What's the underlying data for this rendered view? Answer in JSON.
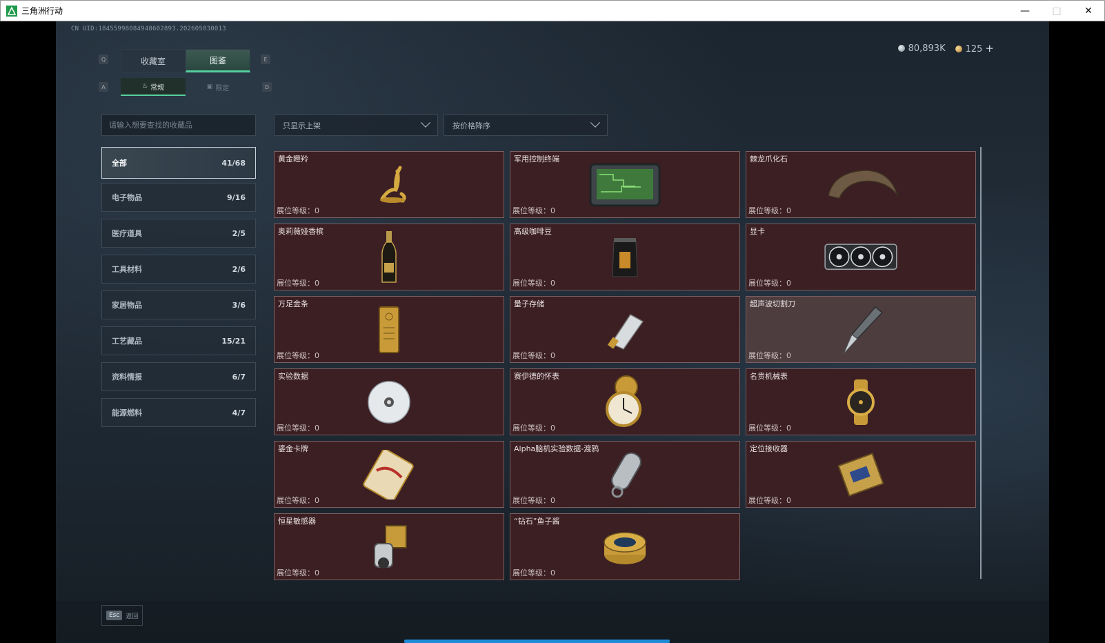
{
  "window": {
    "title": "三角洲行动"
  },
  "header": {
    "uid": "CN UID:18455998084948602893.202605030013",
    "currency_silver": "80,893K",
    "currency_gold": "125",
    "plus": "+"
  },
  "tabs": [
    {
      "label": "收藏室",
      "active": false
    },
    {
      "label": "图鉴",
      "active": true
    }
  ],
  "tab_keys": {
    "left": "Q",
    "right": "E"
  },
  "subtabs": [
    {
      "label": "常规",
      "active": true
    },
    {
      "label": "限定",
      "active": false
    }
  ],
  "subtab_keys": {
    "left": "A",
    "right": "D"
  },
  "search": {
    "placeholder": "请输入想要查找的收藏品"
  },
  "filters": {
    "listing": "只显示上架",
    "sort": "按价格降序"
  },
  "categories": [
    {
      "label": "全部",
      "count": "41/68",
      "active": true
    },
    {
      "label": "电子物品",
      "count": "9/16"
    },
    {
      "label": "医疗道具",
      "count": "2/5"
    },
    {
      "label": "工具材料",
      "count": "2/6"
    },
    {
      "label": "家居物品",
      "count": "3/6"
    },
    {
      "label": "工艺藏品",
      "count": "15/21"
    },
    {
      "label": "资料情报",
      "count": "6/7"
    },
    {
      "label": "能源燃料",
      "count": "4/7"
    }
  ],
  "level_label": "展位等级：",
  "items": [
    {
      "name": "黄金瞪羚",
      "level": "0",
      "icon": "gazelle-icon"
    },
    {
      "name": "军用控制终端",
      "level": "0",
      "icon": "terminal-icon"
    },
    {
      "name": "棘龙爪化石",
      "level": "0",
      "icon": "claw-icon"
    },
    {
      "name": "奥莉薇娅香槟",
      "level": "0",
      "icon": "bottle-icon"
    },
    {
      "name": "高级咖啡豆",
      "level": "0",
      "icon": "coffee-bag-icon"
    },
    {
      "name": "显卡",
      "level": "0",
      "icon": "gpu-icon"
    },
    {
      "name": "万足金条",
      "level": "0",
      "icon": "gold-bar-icon"
    },
    {
      "name": "量子存储",
      "level": "0",
      "icon": "usb-icon"
    },
    {
      "name": "超声波切割刀",
      "level": "0",
      "icon": "knife-icon",
      "highlight": true
    },
    {
      "name": "实验数据",
      "level": "0",
      "icon": "disc-icon"
    },
    {
      "name": "赛伊德的怀表",
      "level": "0",
      "icon": "pocket-watch-icon"
    },
    {
      "name": "名贵机械表",
      "level": "0",
      "icon": "wristwatch-icon"
    },
    {
      "name": "鎏金卡牌",
      "level": "0",
      "icon": "card-icon"
    },
    {
      "name": "Alpha脑机实验数据-渡鸦",
      "level": "0",
      "icon": "capsule-icon"
    },
    {
      "name": "定位接收器",
      "level": "0",
      "icon": "receiver-icon"
    },
    {
      "name": "恒星敏感器",
      "level": "0",
      "icon": "sensor-icon"
    },
    {
      "name": "“钻石”鱼子酱",
      "level": "0",
      "icon": "caviar-icon"
    }
  ],
  "footer": {
    "esc_key": "Esc",
    "back_label": "返回"
  }
}
